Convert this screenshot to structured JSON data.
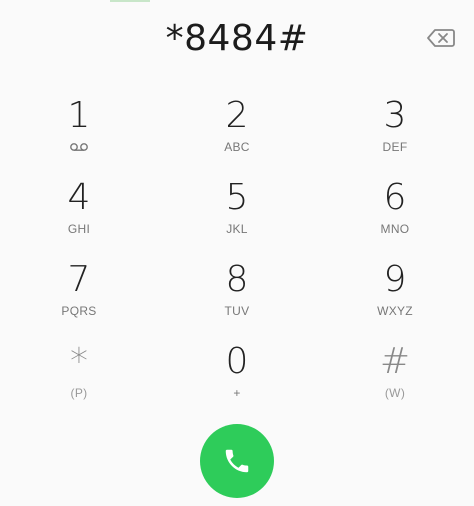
{
  "dialer": {
    "number": "*8484#",
    "keys": [
      {
        "digit": "1",
        "sub": "",
        "icon": "voicemail-icon"
      },
      {
        "digit": "2",
        "sub": "ABC"
      },
      {
        "digit": "3",
        "sub": "DEF"
      },
      {
        "digit": "4",
        "sub": "GHI"
      },
      {
        "digit": "5",
        "sub": "JKL"
      },
      {
        "digit": "6",
        "sub": "MNO"
      },
      {
        "digit": "7",
        "sub": "PQRS"
      },
      {
        "digit": "8",
        "sub": "TUV"
      },
      {
        "digit": "9",
        "sub": "WXYZ"
      },
      {
        "digit": "*",
        "sub": "(P)"
      },
      {
        "digit": "0",
        "sub": "+"
      },
      {
        "digit": "#",
        "sub": "(W)"
      }
    ],
    "backspace_icon": "backspace-icon",
    "call_icon": "phone-icon",
    "call_color": "#2ecc5a"
  }
}
